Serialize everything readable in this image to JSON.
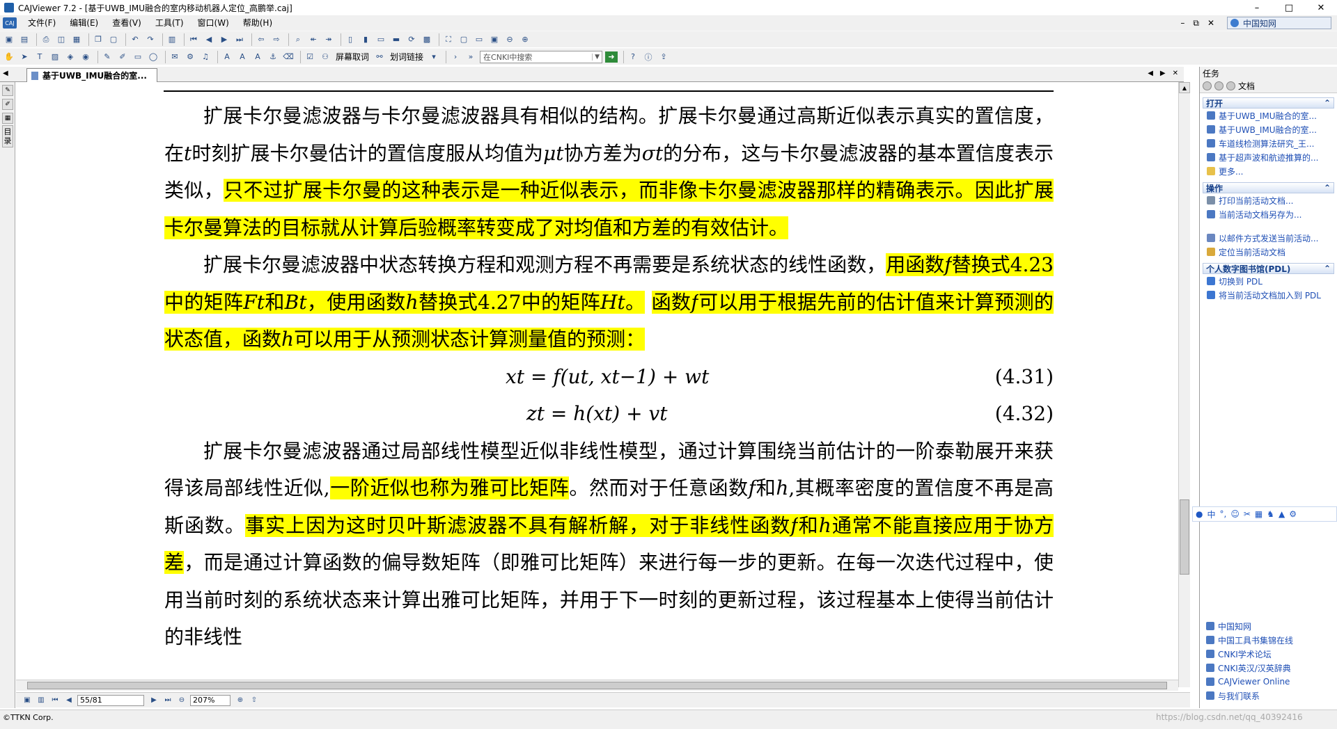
{
  "window": {
    "title": "CAJViewer 7.2 - [基于UWB_IMU融合的室内移动机器人定位_高鹏举.caj]",
    "controls": [
      "–",
      "□",
      "✕"
    ]
  },
  "menu": {
    "items": [
      "文件(F)",
      "编辑(E)",
      "查看(V)",
      "工具(T)",
      "窗口(W)",
      "帮助(H)"
    ],
    "right_controls": [
      "–",
      "⧉",
      "✕"
    ],
    "brand": "中国知网"
  },
  "toolbar2": {
    "screen_capture": "屏幕取词",
    "word_link": "划词链接",
    "search_placeholder": "在CNKI中搜索"
  },
  "tab": {
    "label": "基于UWB_IMU融合的室..."
  },
  "document": {
    "p1": [
      {
        "t": "扩展卡尔曼滤波器与卡尔曼滤波器具有相似的结构。扩展卡尔曼通过高斯近似表示真实的置信度，在",
        "h": false
      },
      {
        "t": "t",
        "h": false,
        "m": true
      },
      {
        "t": "时刻扩展卡尔曼估计的置信度服从均值为",
        "h": false
      },
      {
        "t": "μt",
        "h": false,
        "m": true
      },
      {
        "t": "协方差为",
        "h": false
      },
      {
        "t": "σt",
        "h": false,
        "m": true
      },
      {
        "t": "的分布，这与卡尔曼滤波器的基本置信度表示类似，",
        "h": false
      },
      {
        "t": "只不过扩展卡尔曼的这种表示是一种近似表示，而非像卡尔曼滤波器那样的精确表示。因此扩展卡尔曼算法的目标就从计算后验概率转变成了对均值和方差的有效估计。",
        "h": true
      }
    ],
    "p2": [
      {
        "t": "扩展卡尔曼滤波器中状态转换方程和观测方程不再需要是系统状态的线性函数，",
        "h": false
      },
      {
        "t": "用函数",
        "h": true
      },
      {
        "t": "f",
        "h": true,
        "m": true
      },
      {
        "t": "替换式4.23中的矩阵",
        "h": true
      },
      {
        "t": "Ft",
        "h": true,
        "m": true
      },
      {
        "t": "和",
        "h": true
      },
      {
        "t": "Bt",
        "h": true,
        "m": true
      },
      {
        "t": "，使用函数",
        "h": true
      },
      {
        "t": "h",
        "h": true,
        "m": true
      },
      {
        "t": "替换式4.27中的矩阵",
        "h": true
      },
      {
        "t": "Ht",
        "h": true,
        "m": true
      },
      {
        "t": "。",
        "h": true
      },
      {
        "t": " ",
        "h": false
      },
      {
        "t": "函数",
        "h": true
      },
      {
        "t": "f",
        "h": true,
        "m": true
      },
      {
        "t": "可以用于根据先前的估计值来计算预测的状态值，函数",
        "h": true
      },
      {
        "t": "h",
        "h": true,
        "m": true
      },
      {
        "t": "可以用于从预测状态计算测量值的预测：",
        "h": true
      }
    ],
    "eq1": {
      "expr": "xt = f(ut, xt−1) + wt",
      "num": "(4.31)"
    },
    "eq2": {
      "expr": "zt = h(xt) + vt",
      "num": "(4.32)"
    },
    "p3": [
      {
        "t": "扩展卡尔曼滤波器通过局部线性模型近似非线性模型，通过计算围绕当前估计的一阶泰勒展开来获得该局部线性近似,",
        "h": false
      },
      {
        "t": "一阶近似也称为雅可比矩阵",
        "h": true
      },
      {
        "t": "。然而对于任意函数",
        "h": false
      },
      {
        "t": "f",
        "h": false,
        "m": true
      },
      {
        "t": "和",
        "h": false
      },
      {
        "t": "h",
        "h": false,
        "m": true
      },
      {
        "t": ",其概率密度的置信度不再是高斯函数。",
        "h": false
      },
      {
        "t": "事实上因为这时贝叶斯滤波器不具有解析解，对于非线性函数",
        "h": true
      },
      {
        "t": "f",
        "h": true,
        "m": true
      },
      {
        "t": "和",
        "h": true
      },
      {
        "t": "h",
        "h": true,
        "m": true
      },
      {
        "t": "通常不能直接应用于协方差",
        "h": true
      },
      {
        "t": "，而是通过计算函数的偏导数矩阵（即雅可比矩阵）来进行每一步的更新。在每一次迭代过程中，使用当前时刻的系统状态来计算出雅可比矩阵，并用于下一时刻的更新过程，该过程基本上使得当前估计的非线性",
        "h": false
      }
    ]
  },
  "navbar": {
    "page": "55/81",
    "zoom": "207%"
  },
  "status": {
    "copyright": "©TTKN Corp."
  },
  "taskpane": {
    "title": "任务",
    "doc_label": "文档",
    "open": {
      "title": "打开",
      "items": [
        "基于UWB_IMU融合的室...",
        "基于UWB_IMU融合的室...",
        "车道线检测算法研究_王...",
        "基于超声波和航迹推算的...",
        "更多..."
      ]
    },
    "ops": {
      "title": "操作",
      "items": [
        "打印当前活动文档...",
        "当前活动文档另存为...",
        "以邮件方式发送当前活动...",
        "定位当前活动文档"
      ]
    },
    "pdl": {
      "title": "个人数字图书馆(PDL)",
      "items": [
        "切换到 PDL",
        "将当前活动文档加入到 PDL"
      ]
    },
    "links": [
      "中国知网",
      "中国工具书集锦在线",
      "CNKI学术论坛",
      "CNKI英汉/汉英辞典",
      "CAJViewer Online",
      "与我们联系"
    ]
  },
  "ime": {
    "label": "中"
  },
  "watermark": "https://blog.csdn.net/qq_40392416"
}
